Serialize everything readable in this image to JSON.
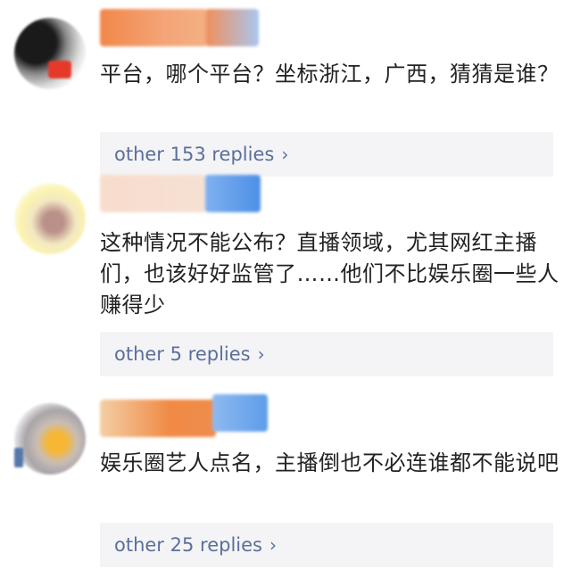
{
  "comments": [
    {
      "text": "平台，哪个平台？坐标浙江，广西，猜猜是谁？",
      "replies_label": "other 153 replies",
      "chevron": "›"
    },
    {
      "text": "这种情况不能公布？直播领域，尤其网红主播们，也该好好监管了……他们不比娱乐圈一些人赚得少",
      "replies_label": "other 5 replies",
      "chevron": "›"
    },
    {
      "text": "娱乐圈艺人点名，主播倒也不必连谁都不能说吧",
      "replies_label": "other 25 replies",
      "chevron": "›"
    }
  ],
  "icons": {
    "avatar": "avatar-icon",
    "chevron": "chevron-right-icon"
  },
  "colors": {
    "reply_link": "#5b6f9c",
    "reply_bg": "#f4f4f6",
    "text": "#222222"
  }
}
